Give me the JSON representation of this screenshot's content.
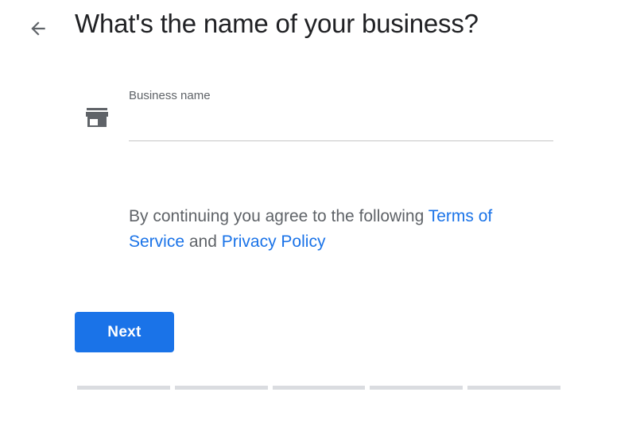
{
  "header": {
    "back_icon": "arrow-left-icon",
    "title": "What's the name of your business?"
  },
  "business_name_field": {
    "icon": "storefront-icon",
    "label": "Business name",
    "value": "",
    "placeholder": ""
  },
  "terms": {
    "prefix": "By continuing you agree to the following ",
    "terms_link": "Terms of Service",
    "conjunction": " and ",
    "privacy_link": "Privacy Policy"
  },
  "actions": {
    "next_label": "Next"
  },
  "progress": {
    "total_steps": 5,
    "completed_steps": 0
  },
  "colors": {
    "accent": "#1a73e8",
    "title_text": "#202124",
    "secondary_text": "#5f6368",
    "progress_track": "#dadce0",
    "underline": "#c6c6c6"
  }
}
